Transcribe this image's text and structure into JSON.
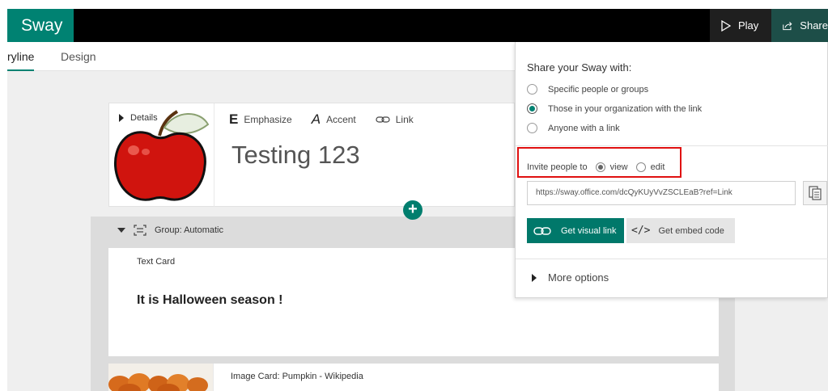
{
  "app": {
    "name": "Sway"
  },
  "header": {
    "play_label": "Play",
    "share_label": "Share"
  },
  "tabs": [
    {
      "label": "ryline"
    },
    {
      "label": "Design"
    }
  ],
  "title_card": {
    "details_label": "Details",
    "toolbar": {
      "emphasize": "Emphasize",
      "accent": "Accent",
      "link": "Link"
    },
    "title": "Testing 123"
  },
  "group": {
    "header": "Group: Automatic",
    "text_card": {
      "label": "Text Card",
      "body": "It is Halloween season !"
    },
    "image_card": {
      "label": "Image Card: Pumpkin - Wikipedia"
    }
  },
  "share_panel": {
    "heading": "Share your Sway with:",
    "options": [
      {
        "label": "Specific people or groups",
        "selected": false
      },
      {
        "label": "Those in your organization with the link",
        "selected": true
      },
      {
        "label": "Anyone with a link",
        "selected": false
      }
    ],
    "invite": {
      "label": "Invite people to",
      "view_label": "view",
      "edit_label": "edit",
      "selected": "view"
    },
    "link_value": "https://sway.office.com/dcQyKUyVvZSCLEaB?ref=Link",
    "visual_link_label": "Get visual link",
    "embed_label": "Get embed code",
    "more_options_label": "More options"
  },
  "colors": {
    "brand": "#008272",
    "highlight": "#e01010"
  }
}
